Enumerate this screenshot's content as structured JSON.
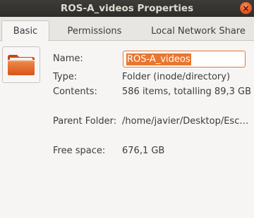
{
  "window": {
    "title": "ROS-A_videos Properties",
    "close_symbol": "×",
    "close_icon": "close-icon"
  },
  "tabs": [
    {
      "label": "Basic",
      "active": true
    },
    {
      "label": "Permissions",
      "active": false
    },
    {
      "label": "Local Network Share",
      "active": false
    }
  ],
  "icon": {
    "name": "folder-icon",
    "color": "#e95420"
  },
  "fields": {
    "name_label": "Name:",
    "name_value": "ROS-A_videos",
    "type_label": "Type:",
    "type_value": "Folder (inode/directory)",
    "contents_label": "Contents:",
    "contents_value": "586 items, totalling 89,3 GB",
    "parent_label": "Parent Folder:",
    "parent_value": "/home/javier/Desktop/Esc…",
    "free_label": "Free space:",
    "free_value": "676,1 GB"
  },
  "colors": {
    "accent": "#e9762f",
    "titlebar": "#3d3c38"
  }
}
